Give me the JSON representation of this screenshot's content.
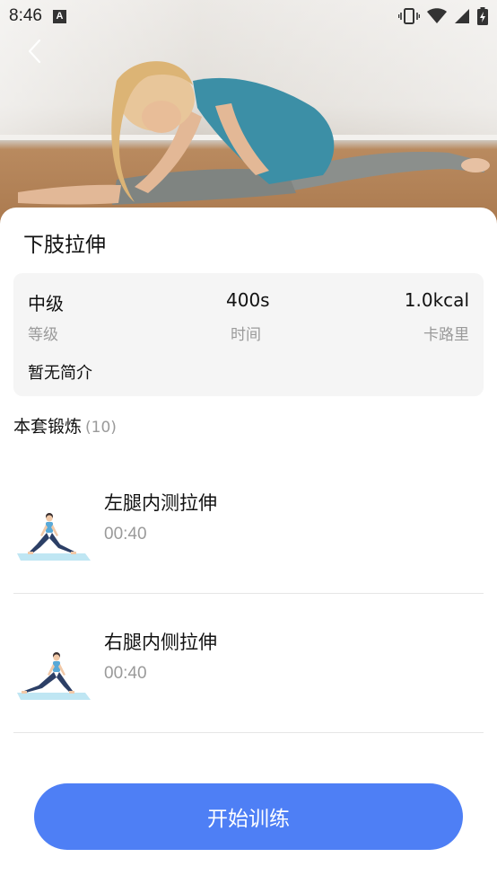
{
  "status_bar": {
    "time": "8:46",
    "notification_letter": "A"
  },
  "workout": {
    "title": "下肢拉伸",
    "level_value": "中级",
    "level_label": "等级",
    "time_value": "400s",
    "time_label": "时间",
    "calorie_value": "1.0kcal",
    "calorie_label": "卡路里",
    "intro": "暂无简介"
  },
  "exercise_section": {
    "title": "本套锻炼",
    "count": "(10)"
  },
  "exercises": [
    {
      "name": "左腿内测拉伸",
      "duration": "00:40",
      "icon": "stretch-left-figure"
    },
    {
      "name": "右腿内侧拉伸",
      "duration": "00:40",
      "icon": "stretch-right-figure"
    }
  ],
  "start_button": {
    "label": "开始训练"
  },
  "colors": {
    "accent": "#4e7ff5",
    "muted_text": "#9a9a9a",
    "card_bg": "#f5f5f5"
  }
}
